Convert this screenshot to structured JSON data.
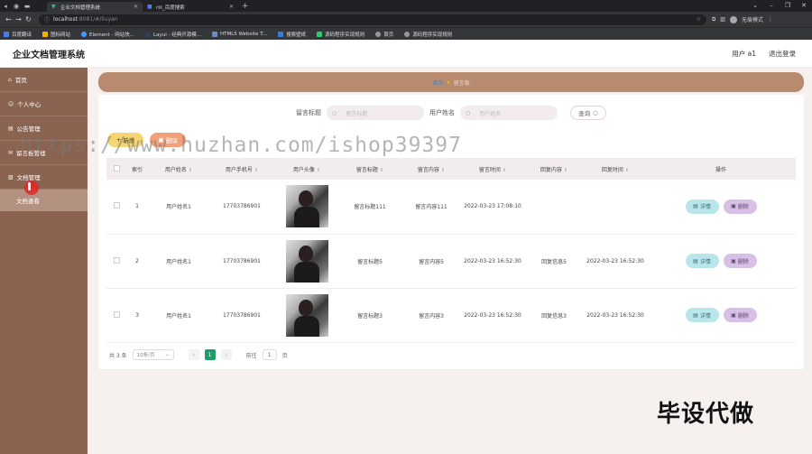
{
  "browser": {
    "tabs": [
      {
        "title": "企业文档管理系统",
        "active": true
      },
      {
        "title": "rili_百度搜索",
        "active": false
      }
    ],
    "url_host": "localhost",
    "url_rest": ":8081/#/liuyan",
    "profile_label": "无痕模式",
    "bookmarks": [
      "百度翻译",
      "图标网站",
      "Element - 网站快...",
      "Layui - 经典开源模...",
      "HTML5 Website T...",
      "搜索壁纸",
      "源码程序实现规则",
      "首页",
      "源码程序实现规则"
    ]
  },
  "app": {
    "title": "企业文档管理系统",
    "user_label": "用户 a1",
    "logout_label": "退出登录"
  },
  "sidebar": {
    "items": [
      {
        "label": "首页"
      },
      {
        "label": "个人中心"
      },
      {
        "label": "公告管理"
      },
      {
        "label": "留言板管理"
      },
      {
        "label": "文档管理"
      }
    ],
    "active_sub": "文档查看"
  },
  "breadcrumb": {
    "home": "首页",
    "current": "留言板"
  },
  "search": {
    "title_label": "留言标题",
    "title_placeholder": "留言标题",
    "name_label": "用户姓名",
    "name_placeholder": "用户姓名",
    "button_label": "查询"
  },
  "actions": {
    "add_label": "新增",
    "delete_label": "删除"
  },
  "table": {
    "headers": [
      "索引",
      "用户姓名",
      "用户手机号",
      "用户头像",
      "留言标题",
      "留言内容",
      "留言时间",
      "回复内容",
      "回复时间",
      "操作"
    ],
    "rows": [
      {
        "index": "1",
        "name": "用户姓名1",
        "phone": "17703786901",
        "title": "留言标题111",
        "content": "留言内容111",
        "time": "2022-03-23 17:08:10",
        "reply": "",
        "reply_time": ""
      },
      {
        "index": "2",
        "name": "用户姓名1",
        "phone": "17703786901",
        "title": "留言标题5",
        "content": "留言内容5",
        "time": "2022-03-23 16:52:30",
        "reply": "回复信息5",
        "reply_time": "2022-03-23 16:52:30"
      },
      {
        "index": "3",
        "name": "用户姓名1",
        "phone": "17703786901",
        "title": "留言标题3",
        "content": "留言内容3",
        "time": "2022-03-23 16:52:30",
        "reply": "回复信息3",
        "reply_time": "2022-03-23 16:52:30"
      }
    ],
    "detail_label": "详情",
    "row_delete_label": "删除"
  },
  "pager": {
    "total": "共 3 条",
    "page_size": "10条/页",
    "current_page": "1",
    "goto_prefix": "前往",
    "goto_value": "1",
    "goto_suffix": "页"
  },
  "overlay": {
    "watermark": "https://www.huzhan.com/ishop39397",
    "corner": "毕设代做"
  },
  "colors": {
    "sidebar": "#8b6451",
    "breadcrumb": "#b88a70",
    "page_active": "#1f9e6c"
  }
}
